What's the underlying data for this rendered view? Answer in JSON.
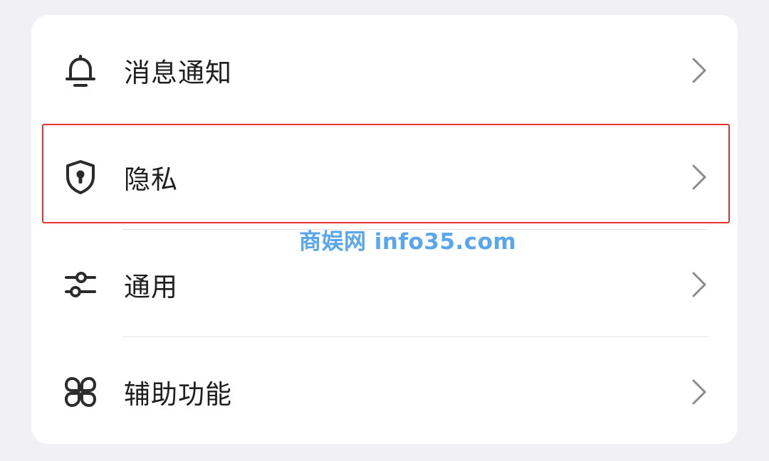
{
  "settings": {
    "items": [
      {
        "label": "消息通知",
        "icon": "bell-icon"
      },
      {
        "label": "隐私",
        "icon": "shield-lock-icon"
      },
      {
        "label": "通用",
        "icon": "sliders-icon"
      },
      {
        "label": "辅助功能",
        "icon": "accessibility-icon"
      }
    ],
    "highlighted_item": "隐私"
  },
  "watermark": "商娱网 info35.com",
  "colors": {
    "background": "#f1f1f5",
    "card": "#ffffff",
    "text": "#1f1f1f",
    "icon": "#2b2b2b",
    "chevron": "#8a8a8a",
    "highlight_border": "#e2332d",
    "watermark": "#5aa6ee"
  }
}
